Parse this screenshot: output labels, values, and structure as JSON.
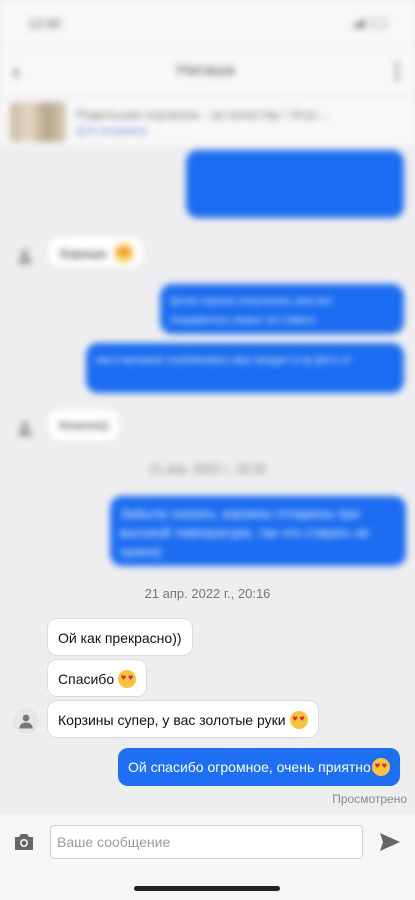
{
  "statusbar": {
    "time": "12:00"
  },
  "header": {
    "title": "Наташа"
  },
  "product": {
    "title": "Родильная корзинка - за качеству / Атус...",
    "link": "Для продавца"
  },
  "blurred": {
    "msg1": "Хорошо",
    "msg2": "фотки хорошо получились мне все понравилось можно ли ставить",
    "msg3": "как в магазине опубликовать ваш продукт в пр фото от",
    "msg4": "Конечно))",
    "date1": "21 апр. 2022 г., 18:33",
    "msg5": "Забыла сказать, корзины отпарены при высокой температуре, так что стирать не нужно)"
  },
  "date2": "21 апр. 2022 г., 20:16",
  "messages": {
    "m1": "Ой как прекрасно))",
    "m2": "Спасибо",
    "m3": "Корзины супер, у вас золотые руки",
    "m4": "Ой спасибо огромное, очень приятно"
  },
  "seen": "Просмотрено",
  "input": {
    "placeholder": "Ваше сообщение"
  },
  "colors": {
    "outgoing": "#1f6ff2",
    "incoming": "#ffffff",
    "background": "#eeeef0"
  }
}
